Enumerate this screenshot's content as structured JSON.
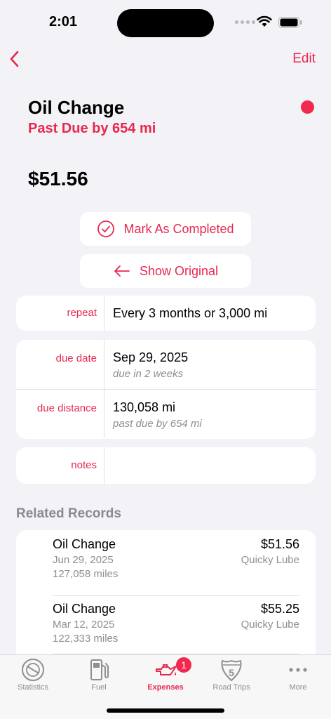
{
  "status_bar": {
    "time": "2:01"
  },
  "nav": {
    "edit_label": "Edit"
  },
  "header": {
    "title": "Oil Change",
    "subtitle": "Past Due by 654 mi",
    "status_color": "#f2294f"
  },
  "price": "$51.56",
  "actions": {
    "complete_label": "Mark As Completed",
    "original_label": "Show Original"
  },
  "details": {
    "repeat": {
      "label": "repeat",
      "value": "Every 3 months or 3,000 mi"
    },
    "due_date": {
      "label": "due date",
      "value": "Sep 29, 2025",
      "sub": "due in 2 weeks"
    },
    "due_distance": {
      "label": "due distance",
      "value": "130,058 mi",
      "sub": "past due by 654 mi"
    },
    "notes": {
      "label": "notes",
      "value": ""
    }
  },
  "related": {
    "heading": "Related Records",
    "records": [
      {
        "name": "Oil Change",
        "amount": "$51.56",
        "date": "Jun 29, 2025",
        "shop": "Quicky Lube",
        "miles": "127,058 miles"
      },
      {
        "name": "Oil Change",
        "amount": "$55.25",
        "date": "Mar 12, 2025",
        "shop": "Quicky Lube",
        "miles": "122,333 miles"
      }
    ]
  },
  "tabs": [
    {
      "label": "Statistics",
      "icon": "gauge-icon"
    },
    {
      "label": "Fuel",
      "icon": "fuel-pump-icon"
    },
    {
      "label": "Expenses",
      "icon": "oil-can-icon",
      "badge": "1",
      "active": true
    },
    {
      "label": "Road Trips",
      "icon": "highway-sign-icon",
      "sign_number": "5"
    },
    {
      "label": "More",
      "icon": "ellipsis-icon"
    }
  ],
  "colors": {
    "accent": "#e8284f",
    "background": "#f2f2f7",
    "badge": "#f2294f"
  }
}
